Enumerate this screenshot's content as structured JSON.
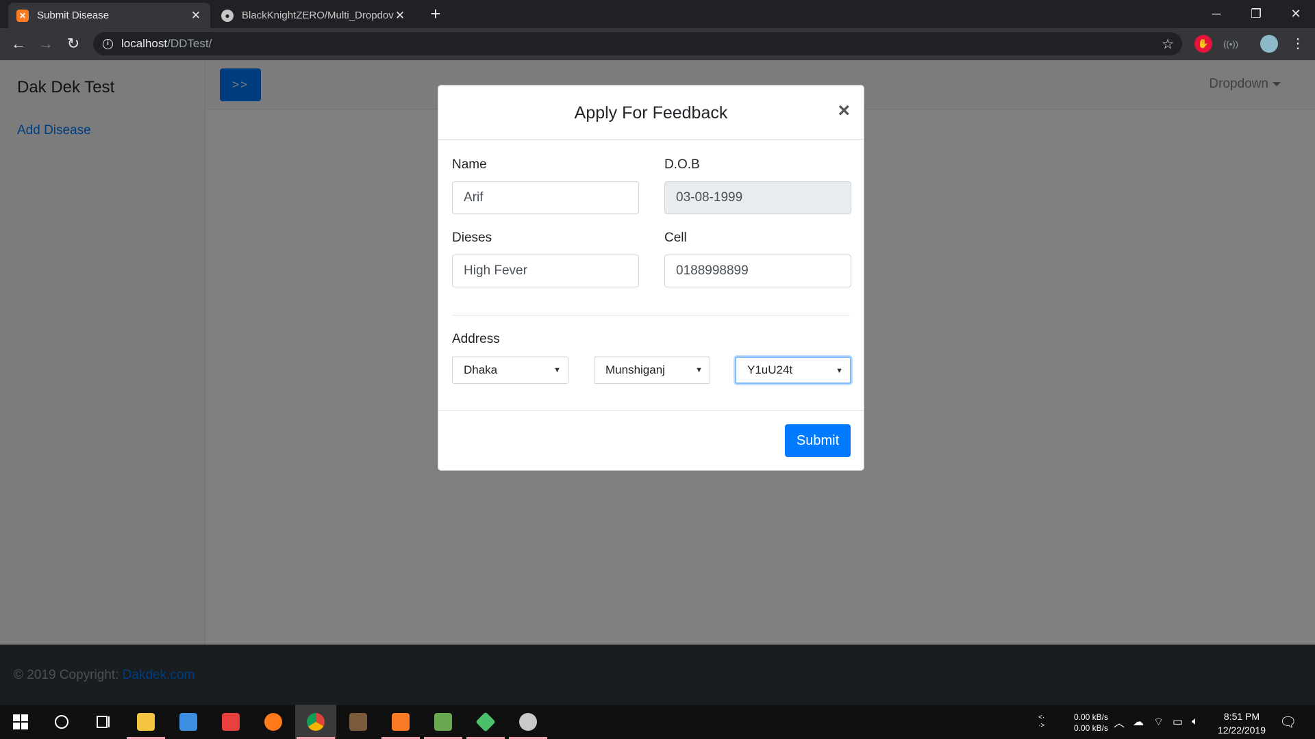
{
  "browser": {
    "tabs": [
      {
        "title": "Submit Disease",
        "active": true
      },
      {
        "title": "BlackKnightZERO/Multi_Dropdov",
        "active": false
      }
    ],
    "url_host": "localhost",
    "url_path": "/DDTest/"
  },
  "app": {
    "brand": "Dak Dek Test",
    "sidebar_link": "Add Disease",
    "toggle_label": ">>",
    "dropdown_label": "Dropdown",
    "footer_prefix": "© 2019 Copyright:",
    "footer_link": "Dakdek.com"
  },
  "modal": {
    "title": "Apply For Feedback",
    "close_symbol": "×",
    "fields": {
      "name_label": "Name",
      "name_value": "Arif",
      "dob_label": "D.O.B",
      "dob_value": "03-08-1999",
      "disease_label": "Dieses",
      "disease_value": "High Fever",
      "cell_label": "Cell",
      "cell_value": "0188998899"
    },
    "address_label": "Address",
    "selects": {
      "division": "Dhaka",
      "district": "Munshiganj",
      "area": "Y1uU24t"
    },
    "submit_label": "Submit"
  },
  "taskbar": {
    "net_up": "0.00 kB/s",
    "net_down": "0.00 kB/s",
    "time": "8:51 PM",
    "date": "12/22/2019"
  },
  "colors": {
    "primary": "#007bff",
    "footer_bg": "#343a40",
    "chrome_dark": "#202124"
  }
}
